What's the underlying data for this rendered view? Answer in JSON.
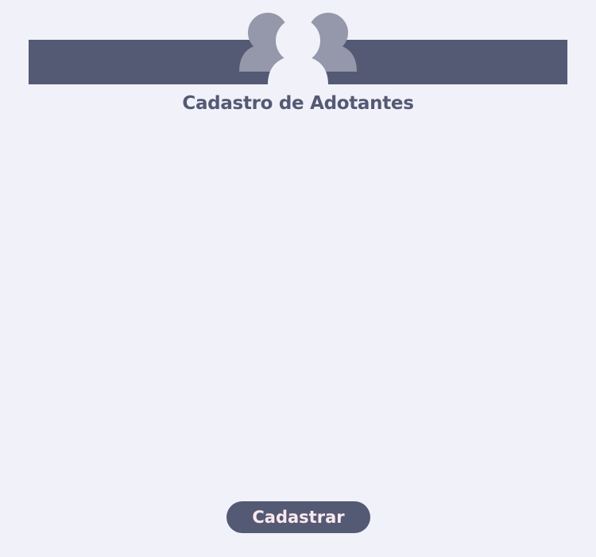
{
  "header": {
    "icon": "users-group-icon",
    "title": "Cadastro de Adotantes"
  },
  "form": {
    "submit_label": "Cadastrar"
  },
  "colors": {
    "background": "#f0f1f9",
    "primary": "#545974",
    "icon_back": "#9597aa",
    "icon_front": "#f0f1f9",
    "button_text": "#fbe9ee"
  }
}
